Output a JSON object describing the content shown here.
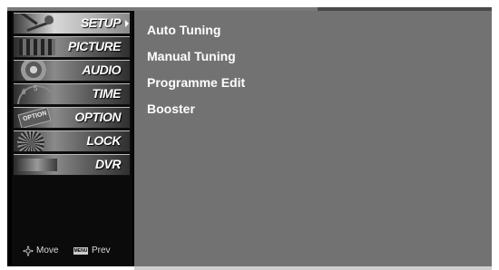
{
  "menu": {
    "items": [
      {
        "label": "SETUP",
        "active": true,
        "icon": "setup-icon"
      },
      {
        "label": "PICTURE",
        "active": false,
        "icon": "picture-icon"
      },
      {
        "label": "AUDIO",
        "active": false,
        "icon": "audio-icon"
      },
      {
        "label": "TIME",
        "active": false,
        "icon": "time-icon"
      },
      {
        "label": "OPTION",
        "active": false,
        "icon": "option-icon"
      },
      {
        "label": "LOCK",
        "active": false,
        "icon": "lock-icon"
      },
      {
        "label": "DVR",
        "active": false,
        "icon": "dvr-icon"
      }
    ]
  },
  "footer": {
    "move_label": "Move",
    "menu_key_label": "MENU",
    "prev_label": "Prev"
  },
  "content": {
    "options": [
      "Auto Tuning",
      "Manual Tuning",
      "Programme Edit",
      "Booster"
    ]
  }
}
